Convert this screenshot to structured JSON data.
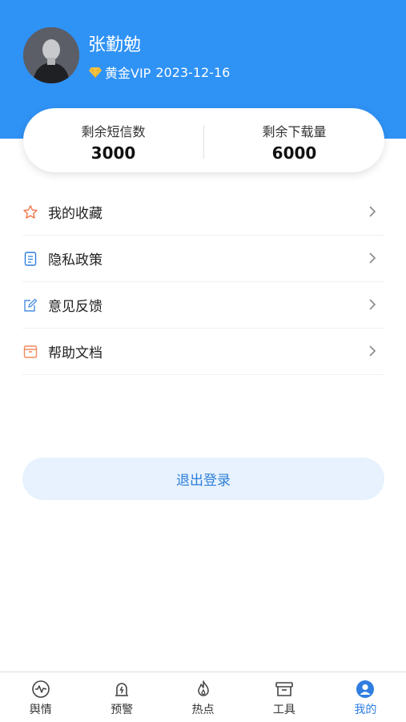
{
  "profile": {
    "name": "张勤勉",
    "vip_level": "黄金VIP",
    "vip_expiry": "2023-12-16"
  },
  "stats": {
    "sms_label": "剩余短信数",
    "sms_value": "3000",
    "download_label": "剩余下载量",
    "download_value": "6000"
  },
  "menu": {
    "items": [
      {
        "label": "我的收藏",
        "icon": "star-icon"
      },
      {
        "label": "隐私政策",
        "icon": "document-icon"
      },
      {
        "label": "意见反馈",
        "icon": "edit-icon"
      },
      {
        "label": "帮助文档",
        "icon": "archive-icon"
      }
    ]
  },
  "logout_label": "退出登录",
  "tabbar": {
    "tabs": [
      {
        "label": "舆情",
        "icon": "pulse-icon"
      },
      {
        "label": "预警",
        "icon": "alarm-icon"
      },
      {
        "label": "热点",
        "icon": "flame-icon"
      },
      {
        "label": "工具",
        "icon": "toolbox-icon"
      },
      {
        "label": "我的",
        "icon": "user-icon",
        "active": true
      }
    ]
  },
  "colors": {
    "header_blue": "#2f92f5",
    "vip_gold": "#f6c445",
    "accent_blue": "#2f7de0",
    "logout_bg": "#e7f2fe"
  }
}
